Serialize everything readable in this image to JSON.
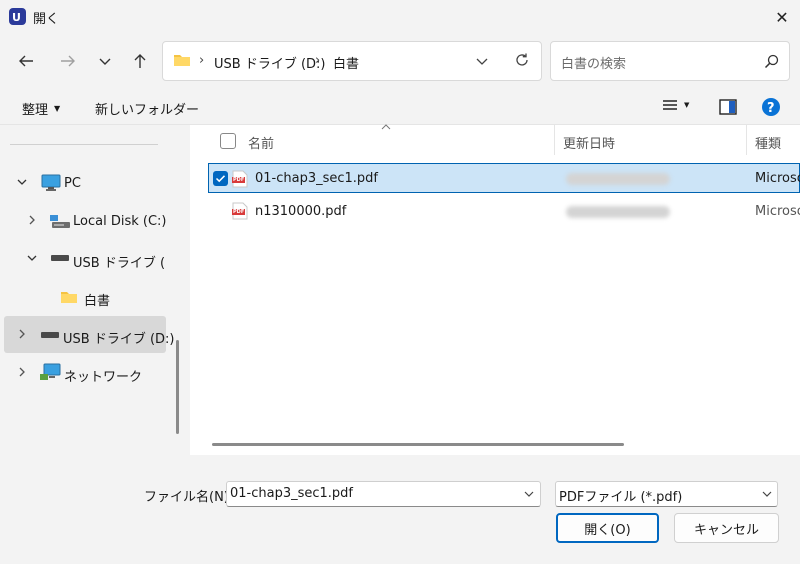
{
  "window": {
    "title": "開く",
    "close_glyph": "✕"
  },
  "address": {
    "segments": [
      "USB ドライブ (D:)",
      "白書"
    ],
    "separator": "›"
  },
  "search": {
    "placeholder": "白書の検索"
  },
  "toolbar": {
    "organize": "整理",
    "new_folder": "新しいフォルダー"
  },
  "tree": {
    "pc": "PC",
    "local_disk": "Local Disk (C:)",
    "usb_expanded": "USB ドライブ (D:)",
    "folder": "白書",
    "usb_selected": "USB ドライブ (D:)",
    "network": "ネットワーク"
  },
  "columns": {
    "name": "名前",
    "modified": "更新日時",
    "type": "種類"
  },
  "files": [
    {
      "name": "01-chap3_sec1.pdf",
      "type": "Microso",
      "selected": true,
      "icon_label": "PDF"
    },
    {
      "name": "n1310000.pdf",
      "type": "Microso",
      "selected": false,
      "icon_label": "PDF"
    }
  ],
  "footer": {
    "filename_label": "ファイル名(N):",
    "filename_value": "01-chap3_sec1.pdf",
    "filter_value": "PDFファイル (*.pdf)",
    "open_button": "開く(O)",
    "cancel_button": "キャンセル"
  },
  "colors": {
    "accent": "#0067c0",
    "selection": "#cce4f7",
    "folder": "#f5c342",
    "pdf": "#d83b3b",
    "help": "#0a73d6"
  }
}
